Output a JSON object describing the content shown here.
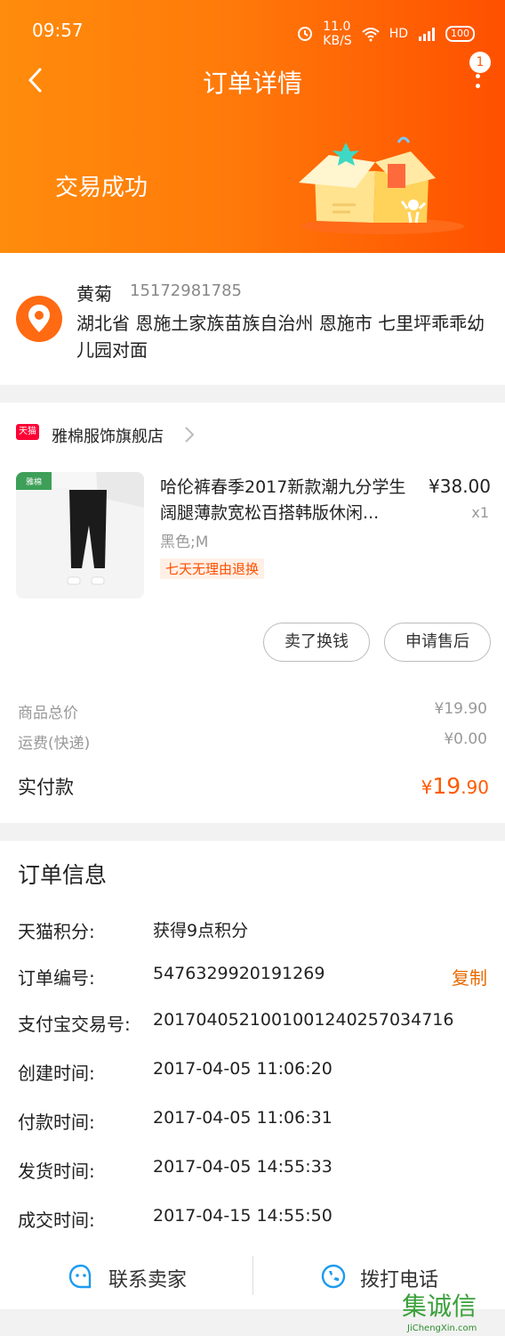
{
  "status_bar": {
    "time": "09:57",
    "speed": "11.0",
    "speed_unit": "KB/S",
    "network": "HD",
    "battery": "100"
  },
  "nav": {
    "title": "订单详情",
    "badge_count": "1"
  },
  "order_status": "交易成功",
  "address": {
    "name": "黄菊",
    "phone": "15172981785",
    "full": "湖北省 恩施土家族苗族自治州 恩施市 七里坪乖乖幼儿园对面"
  },
  "shop": {
    "badge": "天猫",
    "name": "雅棉服饰旗舰店"
  },
  "product": {
    "thumb_brand": "雅棉",
    "name": "哈伦裤春季2017新款潮九分学生阔腿薄款宽松百搭韩版休闲...",
    "price": "¥38.00",
    "qty": "x1",
    "spec": "黑色;M",
    "tag": "七天无理由退换"
  },
  "buttons": {
    "sell": "卖了换钱",
    "after_sale": "申请售后"
  },
  "summary": {
    "goods_label": "商品总价",
    "goods_value": "¥19.90",
    "shipping_label": "运费(快递)",
    "shipping_value": "¥0.00",
    "paid_label": "实付款",
    "paid_prefix": "¥",
    "paid_int": "19",
    "paid_dec": ".90"
  },
  "order_info": {
    "title": "订单信息",
    "copy": "复制",
    "rows": [
      {
        "label": "天猫积分:",
        "value": "获得9点积分"
      },
      {
        "label": "订单编号:",
        "value": "5476329920191269"
      },
      {
        "label": "支付宝交易号:",
        "value": "2017040521001001240257034716"
      },
      {
        "label": "创建时间:",
        "value": "2017-04-05 11:06:20"
      },
      {
        "label": "付款时间:",
        "value": "2017-04-05 11:06:31"
      },
      {
        "label": "发货时间:",
        "value": "2017-04-05 14:55:33"
      },
      {
        "label": "成交时间:",
        "value": "2017-04-15 14:55:50"
      }
    ]
  },
  "footer": {
    "contact": "联系卖家",
    "call": "拨打电话"
  },
  "watermark": {
    "logo": "集诚信",
    "site": "JiChengXin.com"
  },
  "colors": {
    "accent": "#ff5000",
    "header_start": "#ff8c0c",
    "price_orange": "#ff5a00",
    "link_orange": "#e86a00",
    "tmall_red": "#ff0036",
    "footer_blue": "#1d9bf0"
  }
}
